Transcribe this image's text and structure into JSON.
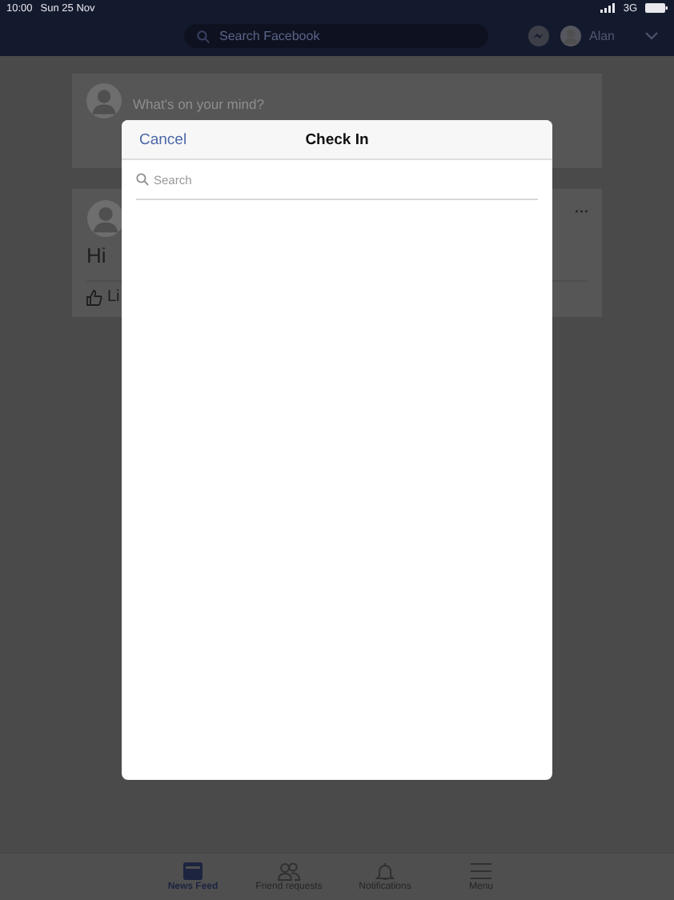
{
  "status_bar": {
    "time": "10:00",
    "date": "Sun 25 Nov",
    "network": "3G"
  },
  "top_bar": {
    "search": {
      "placeholder": "Search Facebook"
    },
    "user": "Alan"
  },
  "composer": {
    "placeholder": "What's on your mind?"
  },
  "post": {
    "text": "Hi",
    "more": "···",
    "like": "Li"
  },
  "dialog": {
    "title": "Check In",
    "cancel": "Cancel",
    "search": {
      "placeholder": "Search"
    }
  },
  "tabs": [
    {
      "kind": "feed",
      "label": "News Feed",
      "selected": true
    },
    {
      "kind": "friends",
      "label": "Friend requests",
      "selected": false
    },
    {
      "kind": "bell",
      "label": "Notifications",
      "selected": false
    },
    {
      "kind": "menu",
      "label": "Menu",
      "selected": false
    }
  ]
}
